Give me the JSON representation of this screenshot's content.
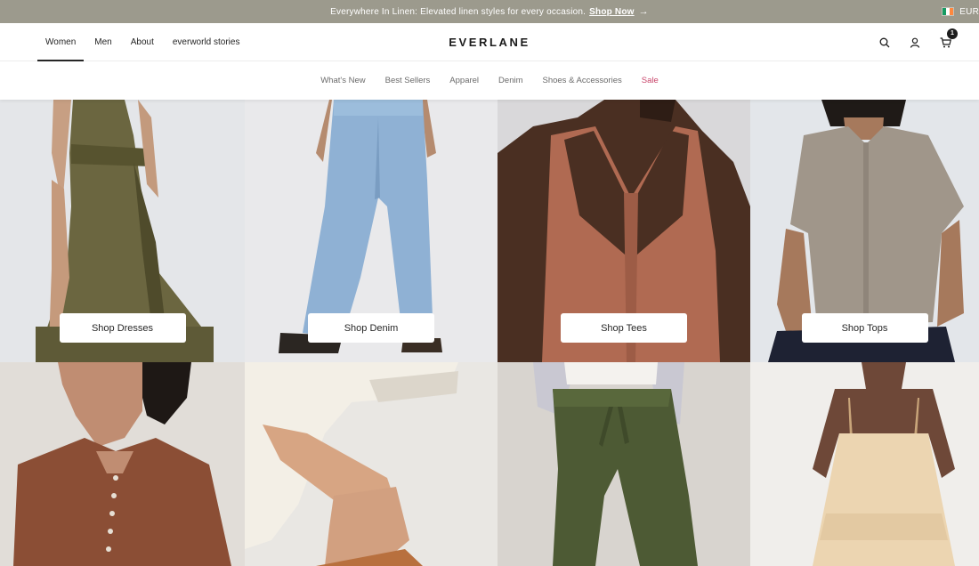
{
  "announcement": {
    "text": "Everywhere In Linen: Elevated linen styles for every occasion.",
    "cta": "Shop Now",
    "arrow": "→",
    "locale": "EUR"
  },
  "header": {
    "nav": [
      "Women",
      "Men",
      "About",
      "everworld stories"
    ],
    "active_nav": "Women",
    "logo": "EVERLANE",
    "cart_count": "1",
    "icons": [
      "search-icon",
      "account-icon",
      "cart-icon"
    ]
  },
  "categories": [
    {
      "label": "What's New",
      "sale": false
    },
    {
      "label": "Best Sellers",
      "sale": false
    },
    {
      "label": "Apparel",
      "sale": false
    },
    {
      "label": "Denim",
      "sale": false
    },
    {
      "label": "Shoes & Accessories",
      "sale": false
    },
    {
      "label": "Sale",
      "sale": true
    }
  ],
  "tiles": [
    {
      "button": "Shop Dresses",
      "image": "olive-dress",
      "bg": "#e7e8ea"
    },
    {
      "button": "Shop Denim",
      "image": "light-wash-jeans",
      "bg": "#eaeaec"
    },
    {
      "button": "Shop Tees",
      "image": "terracotta-tank",
      "bg": "#d8d7d9"
    },
    {
      "button": "Shop Tops",
      "image": "taupe-blouse",
      "bg": "#e4e6ea"
    },
    {
      "button": "",
      "image": "brown-knit",
      "bg": "#e2ddd8"
    },
    {
      "button": "",
      "image": "cream-trousers",
      "bg": "#ebe8e3"
    },
    {
      "button": "",
      "image": "green-pants",
      "bg": "#ddd9d4"
    },
    {
      "button": "",
      "image": "cream-sundress",
      "bg": "#f1efec"
    }
  ],
  "colors": {
    "announce_bg": "#9c9a8d",
    "sale": "#c9466b",
    "text": "#262626"
  }
}
